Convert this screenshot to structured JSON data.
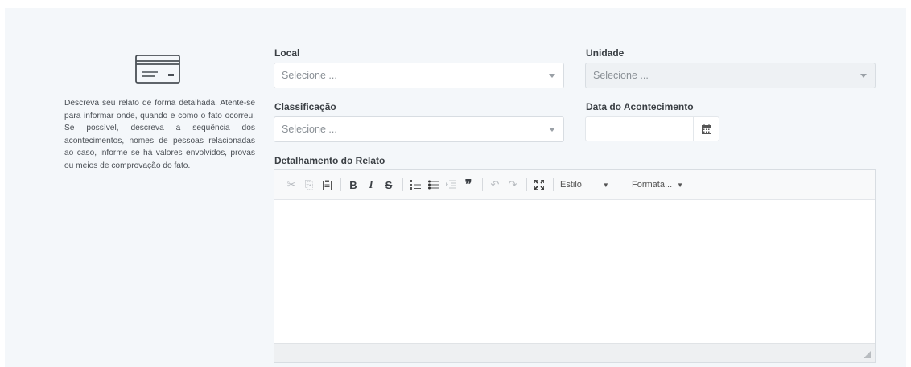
{
  "sidebar": {
    "icon": "credit-card-icon",
    "description": "Descreva seu relato de forma detalhada, Atente-se para informar onde, quando e como o fato ocorreu. Se possível, descreva a sequência dos acontecimentos, nomes de pessoas relacionadas ao caso, informe se há valores envolvidos, provas ou meios de comprovação do fato."
  },
  "fields": {
    "local": {
      "label": "Local",
      "placeholder": "Selecione ..."
    },
    "unidade": {
      "label": "Unidade",
      "placeholder": "Selecione ..."
    },
    "classificacao": {
      "label": "Classificação",
      "placeholder": "Selecione ..."
    },
    "data": {
      "label": "Data do Acontecimento",
      "value": ""
    },
    "detalhamento": {
      "label": "Detalhamento do Relato"
    }
  },
  "toolbar": {
    "estilo": "Estilo",
    "formata": "Formata...",
    "bold": "B",
    "italic": "I",
    "strike": "S",
    "quote": "❞"
  },
  "colors": {
    "panel_bg": "#f4f7fa",
    "border": "#d8dde2",
    "label": "#3a3f44"
  }
}
